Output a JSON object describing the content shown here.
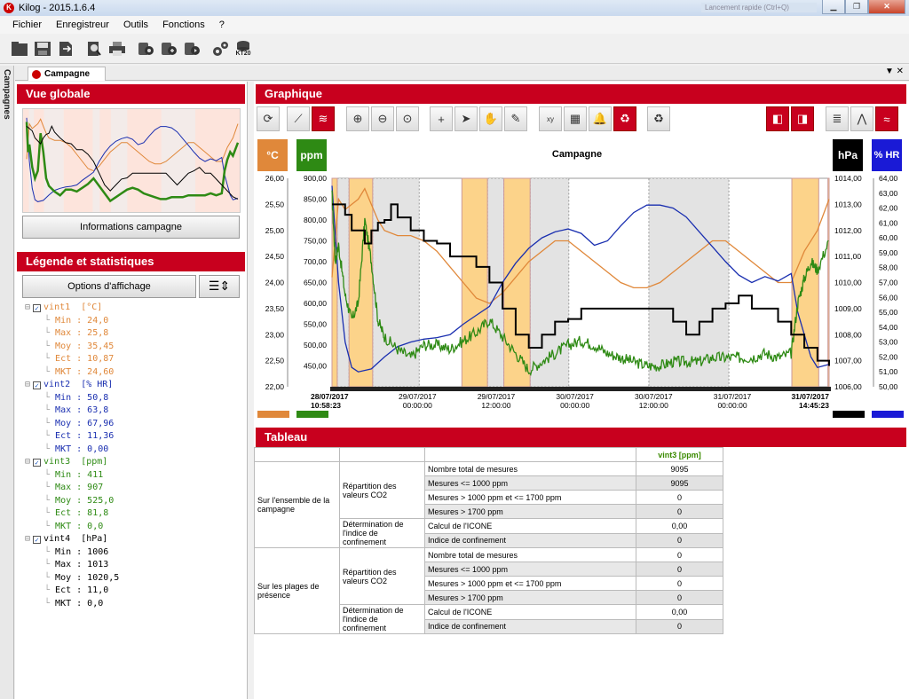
{
  "window": {
    "title": "Kilog - 2015.1.6.4",
    "blurred_text": "Lancement rapide (Ctrl+Q)"
  },
  "menu": [
    "Fichier",
    "Enregistreur",
    "Outils",
    "Fonctions",
    "?"
  ],
  "toolbar": {
    "icons": [
      "folder-icon",
      "save-icon",
      "export-icon",
      "print-preview-icon",
      "print-icon",
      "logger-read-icon",
      "logger-config-icon",
      "logger-start-icon",
      "settings-icon",
      "kt20-icon"
    ],
    "kt20_label": "KT20"
  },
  "side_tab": "Campagnes",
  "doc_tab": "Campagne",
  "vue_globale": {
    "title": "Vue globale",
    "info_button": "Informations campagne"
  },
  "legende": {
    "title": "Légende et statistiques",
    "options_button": "Options d'affichage",
    "channels": [
      {
        "name": "vint1",
        "unit": "[°C]",
        "color": "#e0883a",
        "stats": [
          [
            "Min",
            "24,0"
          ],
          [
            "Max",
            "25,8"
          ],
          [
            "Moy",
            "35,45"
          ],
          [
            "Ect",
            "10,87"
          ],
          [
            "MKT",
            "24,60"
          ]
        ]
      },
      {
        "name": "vint2",
        "unit": "[% HR]",
        "color": "#1a2fb0",
        "stats": [
          [
            "Min",
            "50,8"
          ],
          [
            "Max",
            "63,8"
          ],
          [
            "Moy",
            "67,96"
          ],
          [
            "Ect",
            "11,36"
          ],
          [
            "MKT",
            "0,00"
          ]
        ]
      },
      {
        "name": "vint3",
        "unit": "[ppm]",
        "color": "#2e8a14",
        "stats": [
          [
            "Min",
            "411"
          ],
          [
            "Max",
            "907"
          ],
          [
            "Moy",
            "525,0"
          ],
          [
            "Ect",
            "81,8"
          ],
          [
            "MKT",
            "0,0"
          ]
        ]
      },
      {
        "name": "vint4",
        "unit": "[hPa]",
        "color": "#000000",
        "stats": [
          [
            "Min",
            "1006"
          ],
          [
            "Max",
            "1013"
          ],
          [
            "Moy",
            "1020,5"
          ],
          [
            "Ect",
            "11,0"
          ],
          [
            "MKT",
            "0,0"
          ]
        ]
      }
    ]
  },
  "graphique": {
    "title": "Graphique",
    "chart_title": "Campagne",
    "units": {
      "left1": "°C",
      "left2": "ppm",
      "right1": "hPa",
      "right2": "% HR"
    },
    "colors": {
      "temp": "#e0883a",
      "co2": "#2e8a14",
      "pressure": "#000000",
      "humidity": "#1a2fb0",
      "orange_zone": "#fcd38a",
      "grey_zone": "#e3e3e3"
    }
  },
  "chart_data": {
    "type": "line",
    "title": "Campagne",
    "x_ticks": [
      {
        "date": "28/07/2017",
        "time": "10:58:23",
        "bold": true
      },
      {
        "date": "29/07/2017",
        "time": "00:00:00",
        "bold": false
      },
      {
        "date": "29/07/2017",
        "time": "12:00:00",
        "bold": false
      },
      {
        "date": "30/07/2017",
        "time": "00:00:00",
        "bold": false
      },
      {
        "date": "30/07/2017",
        "time": "12:00:00",
        "bold": false
      },
      {
        "date": "31/07/2017",
        "time": "00:00:00",
        "bold": false
      },
      {
        "date": "31/07/2017",
        "time": "14:45:23",
        "bold": true
      }
    ],
    "x_hours": [
      0,
      13.03,
      25.03,
      37.03,
      49.03,
      61.03,
      75.78
    ],
    "axes": {
      "temp": {
        "unit": "°C",
        "ylim": [
          22.0,
          26.0
        ],
        "ticks": [
          "26,00",
          "25,50",
          "25,00",
          "24,50",
          "24,00",
          "23,50",
          "23,00",
          "22,50",
          "22,00"
        ]
      },
      "co2": {
        "unit": "ppm",
        "ylim": [
          400,
          900
        ],
        "ticks": [
          "900,00",
          "850,00",
          "800,00",
          "750,00",
          "700,00",
          "650,00",
          "600,00",
          "550,00",
          "500,00",
          "450,00"
        ]
      },
      "pressure": {
        "unit": "hPa",
        "ylim": [
          1006,
          1014
        ],
        "ticks": [
          "1014,00",
          "1013,00",
          "1012,00",
          "1011,00",
          "1010,00",
          "1009,00",
          "1008,00",
          "1007,00",
          "1006,00"
        ]
      },
      "humidity": {
        "unit": "% HR",
        "ylim": [
          50,
          64
        ],
        "ticks": [
          "64,00",
          "63,00",
          "62,00",
          "61,00",
          "60,00",
          "59,00",
          "58,00",
          "57,00",
          "56,00",
          "55,00",
          "54,00",
          "53,00",
          "52,00",
          "51,00",
          "50,00"
        ]
      }
    },
    "zones": {
      "orange": [
        [
          0.0,
          0.8
        ],
        [
          2.6,
          6.2
        ],
        [
          19.8,
          23.7
        ],
        [
          26.2,
          30.2
        ],
        [
          70.1,
          74.2
        ],
        [
          75.6,
          75.78
        ]
      ],
      "grey": [
        [
          0.8,
          2.6
        ],
        [
          6.2,
          13.3
        ],
        [
          23.7,
          26.2
        ],
        [
          30.2,
          36.1
        ],
        [
          48.3,
          60.5
        ]
      ]
    },
    "series": [
      {
        "name": "vint1",
        "axis": "temp",
        "color": "#e0883a",
        "x": [
          0,
          1,
          2,
          3,
          4,
          5,
          6,
          7,
          8,
          10,
          12,
          14,
          16,
          18,
          20,
          22,
          24,
          26,
          28,
          30,
          32,
          34,
          36,
          38,
          40,
          42,
          44,
          46,
          48,
          50,
          52,
          54,
          56,
          58,
          60,
          62,
          64,
          66,
          68,
          70,
          72,
          74,
          75.78
        ],
        "y": [
          24.1,
          25.6,
          25.4,
          25.5,
          25.6,
          25.8,
          25.5,
          25.2,
          25.0,
          24.9,
          24.9,
          24.8,
          24.6,
          24.3,
          24.0,
          23.7,
          23.6,
          23.8,
          24.1,
          24.4,
          24.6,
          24.8,
          24.8,
          24.6,
          24.4,
          24.2,
          24.0,
          23.9,
          23.9,
          24.0,
          24.2,
          24.4,
          24.6,
          24.8,
          24.8,
          24.6,
          24.4,
          24.2,
          24.0,
          24.0,
          24.6,
          25.0,
          25.6
        ]
      },
      {
        "name": "vint2",
        "axis": "humidity",
        "color": "#1a2fb0",
        "x": [
          0,
          1,
          2,
          3,
          4,
          6,
          8,
          10,
          12,
          14,
          16,
          18,
          20,
          22,
          24,
          26,
          28,
          30,
          32,
          34,
          36,
          38,
          40,
          42,
          44,
          46,
          48,
          50,
          52,
          54,
          56,
          58,
          60,
          62,
          64,
          66,
          68,
          70,
          71,
          72,
          73,
          74,
          75.78
        ],
        "y": [
          63.5,
          57.0,
          53.0,
          51.3,
          51.0,
          51.2,
          52.0,
          52.7,
          53.0,
          53.2,
          53.3,
          53.5,
          54.2,
          54.8,
          55.4,
          57.0,
          58.3,
          59.3,
          60.0,
          60.4,
          60.6,
          60.3,
          59.5,
          59.8,
          60.8,
          61.7,
          62.2,
          62.2,
          62.0,
          61.4,
          60.4,
          59.4,
          58.4,
          57.5,
          57.0,
          57.4,
          57.1,
          57.6,
          55.0,
          53.5,
          52.0,
          51.3,
          51.5
        ]
      },
      {
        "name": "vint3",
        "axis": "co2",
        "color": "#2e8a14",
        "x": [
          0,
          0.5,
          1,
          2,
          3,
          4,
          5,
          6,
          7,
          8,
          10,
          12,
          14,
          16,
          18,
          20,
          22,
          24,
          26,
          28,
          30,
          32,
          34,
          36,
          38,
          40,
          42,
          44,
          46,
          48,
          50,
          52,
          54,
          56,
          58,
          60,
          62,
          64,
          66,
          68,
          70,
          71,
          72,
          73,
          74,
          75.78
        ],
        "y": [
          860,
          700,
          740,
          620,
          560,
          600,
          800,
          700,
          560,
          520,
          490,
          470,
          500,
          500,
          490,
          510,
          530,
          560,
          520,
          480,
          440,
          460,
          480,
          500,
          510,
          500,
          480,
          470,
          460,
          450,
          450,
          460,
          460,
          460,
          470,
          470,
          470,
          470,
          480,
          470,
          480,
          600,
          660,
          700,
          680,
          750
        ]
      },
      {
        "name": "vint4",
        "axis": "pressure",
        "color": "#000000",
        "x": [
          0,
          2,
          3,
          5,
          6,
          7,
          8,
          9,
          10,
          12,
          14,
          16,
          18,
          20,
          22,
          24,
          26,
          28,
          30,
          32,
          34,
          36,
          38,
          40,
          42,
          44,
          46,
          48,
          50,
          52,
          54,
          56,
          58,
          60,
          62,
          64,
          66,
          68,
          70,
          72,
          74,
          75.78
        ],
        "y": [
          1013.0,
          1012.6,
          1012.0,
          1011.5,
          1012.0,
          1012.3,
          1012.4,
          1013.0,
          1012.5,
          1012.0,
          1011.6,
          1011.5,
          1011.0,
          1011.0,
          1010.6,
          1010.0,
          1009.0,
          1008.0,
          1007.5,
          1008.0,
          1008.5,
          1008.6,
          1009.0,
          1009.0,
          1009.0,
          1009.0,
          1009.0,
          1009.0,
          1009.0,
          1008.5,
          1008.0,
          1008.5,
          1009.0,
          1009.2,
          1009.5,
          1009.0,
          1009.0,
          1008.5,
          1008.0,
          1007.5,
          1007.0,
          1006.8
        ]
      }
    ]
  },
  "tableau": {
    "title": "Tableau",
    "column_header": "vint3 [ppm]",
    "groups": [
      {
        "label": "Sur l'ensemble de la campagne",
        "subgroups": [
          {
            "label": "Répartition des valeurs CO2",
            "rows": [
              [
                "Nombre total de mesures",
                "9095"
              ],
              [
                "Mesures <= 1000 ppm",
                "9095"
              ],
              [
                "Mesures > 1000 ppm et <= 1700 ppm",
                "0"
              ],
              [
                "Mesures > 1700 ppm",
                "0"
              ]
            ]
          },
          {
            "label": "Détermination de l'indice de confinement",
            "rows": [
              [
                "Calcul de l'ICONE",
                "0,00"
              ],
              [
                "Indice de confinement",
                "0"
              ]
            ]
          }
        ]
      },
      {
        "label": "Sur les plages de présence",
        "subgroups": [
          {
            "label": "Répartition des valeurs CO2",
            "rows": [
              [
                "Nombre total de mesures",
                "0"
              ],
              [
                "Mesures <= 1000 ppm",
                "0"
              ],
              [
                "Mesures > 1000 ppm et <= 1700 ppm",
                "0"
              ],
              [
                "Mesures > 1700 ppm",
                "0"
              ]
            ]
          },
          {
            "label": "Détermination de l'indice de confinement",
            "rows": [
              [
                "Calcul de l'ICONE",
                "0,00"
              ],
              [
                "Indice de confinement",
                "0"
              ]
            ]
          }
        ]
      }
    ]
  }
}
